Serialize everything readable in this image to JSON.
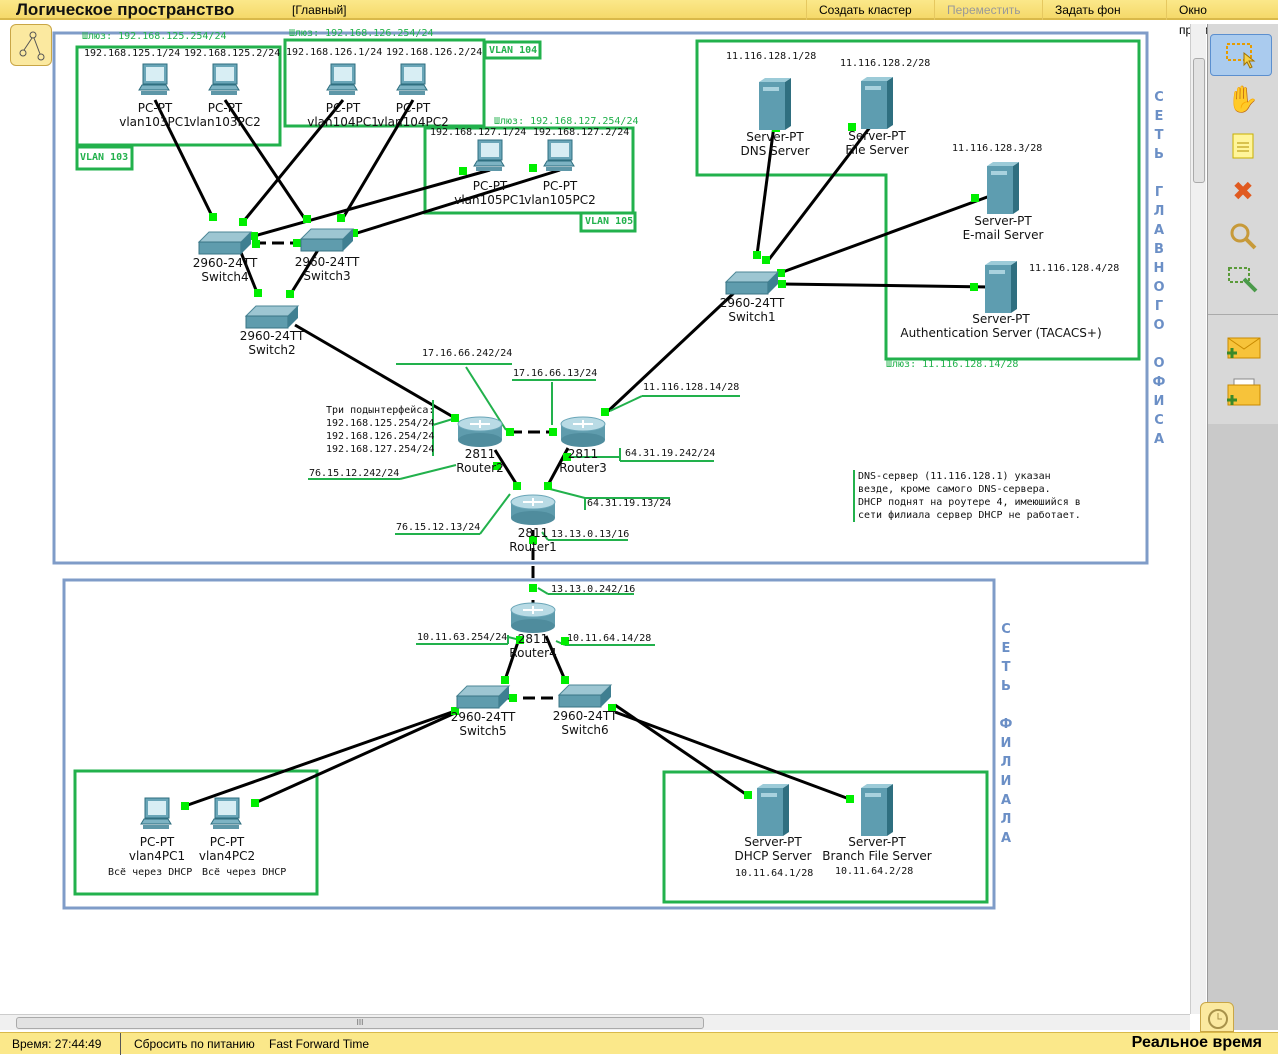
{
  "header": {
    "title": "Логическое пространство",
    "tag": "[Главный]",
    "buttons": [
      "Создать кластер",
      "Переместить",
      "Задать фон",
      "Окно просмотра"
    ]
  },
  "devices": {
    "vlan103PC1": {
      "model": "PC-PT",
      "name": "vlan103PC1"
    },
    "vlan103PC2": {
      "model": "PC-PT",
      "name": "vlan103PC2"
    },
    "vlan104PC1": {
      "model": "PC-PT",
      "name": "vlan104PC1"
    },
    "vlan104PC2": {
      "model": "PC-PT",
      "name": "vlan104PC2"
    },
    "vlan105PC1": {
      "model": "PC-PT",
      "name": "vlan105PC1"
    },
    "vlan105PC2": {
      "model": "PC-PT",
      "name": "vlan105PC2"
    },
    "Switch4": {
      "model": "2960-24TT",
      "name": "Switch4"
    },
    "Switch3": {
      "model": "2960-24TT",
      "name": "Switch3"
    },
    "Switch2": {
      "model": "2960-24TT",
      "name": "Switch2"
    },
    "Switch1": {
      "model": "2960-24TT",
      "name": "Switch1"
    },
    "Router2": {
      "model": "2811",
      "name": "Router2"
    },
    "Router3": {
      "model": "2811",
      "name": "Router3"
    },
    "Router1": {
      "model": "2811",
      "name": "Router1"
    },
    "DNS": {
      "model": "Server-PT",
      "name": "DNS Server"
    },
    "File": {
      "model": "Server-PT",
      "name": "File Server"
    },
    "Email": {
      "model": "Server-PT",
      "name": "E-mail Server"
    },
    "Auth": {
      "model": "Server-PT",
      "name": "Authentication Server (TACACS+)"
    },
    "Router4": {
      "model": "2811",
      "name": "Router4"
    },
    "Switch5": {
      "model": "2960-24TT",
      "name": "Switch5"
    },
    "Switch6": {
      "model": "2960-24TT",
      "name": "Switch6"
    },
    "vlan4PC1": {
      "model": "PC-PT",
      "name": "vlan4PC1"
    },
    "vlan4PC2": {
      "model": "PC-PT",
      "name": "vlan4PC2"
    },
    "DHCP": {
      "model": "Server-PT",
      "name": "DHCP Server"
    },
    "BranchFile": {
      "model": "Server-PT",
      "name": "Branch File Server"
    }
  },
  "ips": [
    "192.168.125.1/24",
    "192.168.125.2/24",
    "192.168.126.1/24",
    "192.168.126.2/24",
    "192.168.127.1/24",
    "192.168.127.2/24",
    "11.116.128.1/28",
    "11.116.128.2/28",
    "11.116.128.3/28",
    "11.116.128.4/28",
    "17.16.66.242/24",
    "17.16.66.13/24",
    "11.116.128.14/28",
    "64.31.19.242/24",
    "64.31.19.13/24",
    "76.15.12.242/24",
    "76.15.12.13/24",
    "13.13.0.13/16",
    "13.13.0.242/16",
    "10.11.63.254/24",
    "10.11.64.14/28",
    "10.11.64.1/28",
    "10.11.64.2/28"
  ],
  "gateways": [
    "Шлюз: 192.168.125.254/24",
    "Шлюз: 192.168.126.254/24",
    "Шлюз: 192.168.127.254/24",
    "Шлюз: 11.116.128.14/28"
  ],
  "vlans": [
    "VLAN 103",
    "VLAN 104",
    "VLAN 105"
  ],
  "subif": [
    "Три подынтерфейса:",
    "192.168.125.254/24",
    "192.168.126.254/24",
    "192.168.127.254/24"
  ],
  "dhcp_notes": [
    "Всё через DHCP",
    "Всё через DHCP"
  ],
  "note": "DNS-сервер (11.116.128.1) указан\nвезде, кроме самого DNS-сервера.\nDHCP поднят на роутере 4, имеюшийся в\nсети филиала сервер DHCP не работает.",
  "main_net_label": "СЕТЬ ГЛАВНОГО ОФИСА",
  "branch_net_label": "СЕТЬ ФИЛИАЛА",
  "status": {
    "time": "Время: 27:44:49",
    "power": "Сбросить по питанию",
    "ff": "Fast Forward Time",
    "mode": "Реальное время"
  },
  "colors": {
    "box": "#22b14c",
    "link_light": "#00ee00",
    "frame": "#7f9cc8",
    "toolbar": "#fbe88a"
  }
}
